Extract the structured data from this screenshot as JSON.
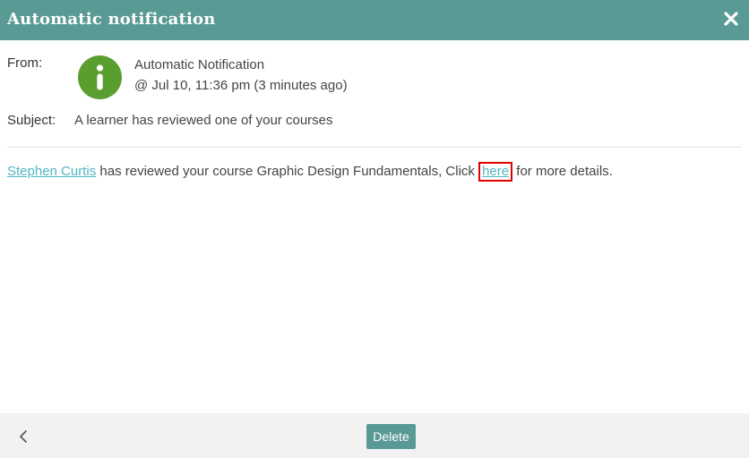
{
  "header": {
    "title": "Automatic notification",
    "close_icon": "close-icon"
  },
  "from": {
    "label": "From:",
    "avatar_icon": "info-icon",
    "avatar_color": "#5a9e2f",
    "sender": "Automatic Notification",
    "timestamp": "@ Jul 10, 11:36 pm (3 minutes ago)"
  },
  "subject": {
    "label": "Subject:",
    "text": "A learner has reviewed one of your courses"
  },
  "message": {
    "user_link": "Stephen Curtis",
    "text_before": " has reviewed your course Graphic Design Fundamentals, Click ",
    "here_link": "here",
    "text_after": " for more details."
  },
  "footer": {
    "back_icon": "chevron-left-icon",
    "delete_label": "Delete"
  },
  "colors": {
    "accent": "#5a9a95",
    "link": "#4fb7c4",
    "highlight": "#e00000"
  }
}
